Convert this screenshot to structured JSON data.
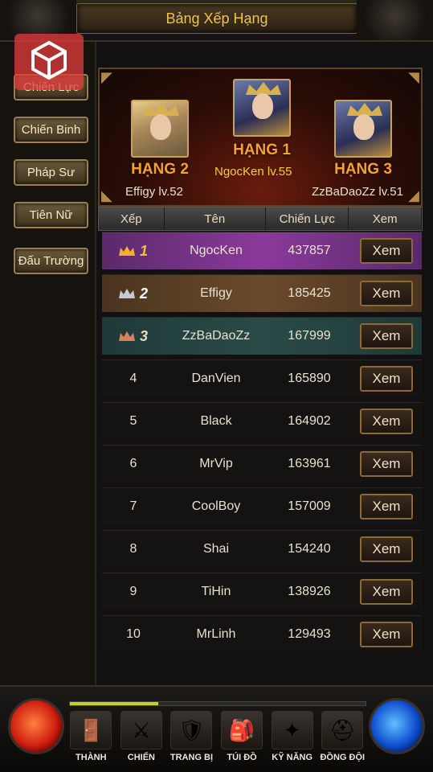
{
  "header": {
    "title": "Bảng Xếp Hạng"
  },
  "sidebar": {
    "items": [
      {
        "label": "Chiến Lực"
      },
      {
        "label": "Chiến Binh"
      },
      {
        "label": "Pháp Sư"
      },
      {
        "label": "Tiên Nữ"
      },
      {
        "label": "Đấu Trường"
      }
    ]
  },
  "podium": {
    "first": {
      "rank_label": "HẠNG 1",
      "name": "NgocKen lv.55"
    },
    "second": {
      "rank_label": "HẠNG 2",
      "name": "Effigy lv.52"
    },
    "third": {
      "rank_label": "HẠNG 3",
      "name": "ZzBaDaoZz lv.51"
    }
  },
  "table": {
    "headers": [
      "Xếp",
      "Tên",
      "Chiến Lực",
      "Xem"
    ],
    "button_label": "Xem",
    "rows": [
      {
        "rank": "1",
        "name": "NgocKen",
        "power": "437857"
      },
      {
        "rank": "2",
        "name": "Effigy",
        "power": "185425"
      },
      {
        "rank": "3",
        "name": "ZzBaDaoZz",
        "power": "167999"
      },
      {
        "rank": "4",
        "name": "DanVien",
        "power": "165890"
      },
      {
        "rank": "5",
        "name": "Black",
        "power": "164902"
      },
      {
        "rank": "6",
        "name": "MrVip",
        "power": "163961"
      },
      {
        "rank": "7",
        "name": "CoolBoy",
        "power": "157009"
      },
      {
        "rank": "8",
        "name": "Shai",
        "power": "154240"
      },
      {
        "rank": "9",
        "name": "TiHin",
        "power": "138926"
      },
      {
        "rank": "10",
        "name": "MrLinh",
        "power": "129493"
      }
    ]
  },
  "bottom_nav": {
    "xp_fraction": 0.3,
    "items": [
      {
        "label": "THÀNH",
        "icon": "gate-icon"
      },
      {
        "label": "CHIẾN",
        "icon": "sword-icon"
      },
      {
        "label": "TRANG BỊ",
        "icon": "armor-icon"
      },
      {
        "label": "TÚI ĐỒ",
        "icon": "bag-icon"
      },
      {
        "label": "KỸ NĂNG",
        "icon": "skill-icon"
      },
      {
        "label": "ĐỒNG ĐỘI",
        "icon": "helmet-icon"
      }
    ]
  },
  "colors": {
    "accent": "#f0c24a",
    "rank1_row": "#8a3a9a",
    "rank2_row": "#6a4a2a",
    "rank3_row": "#2a4a48"
  }
}
